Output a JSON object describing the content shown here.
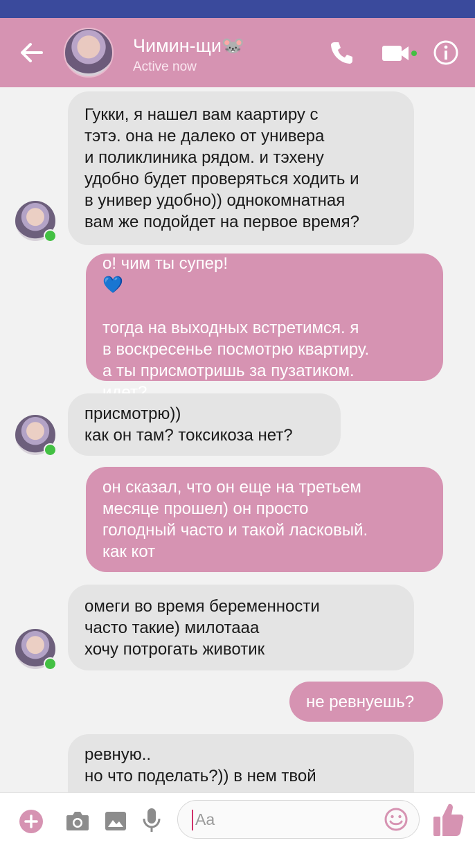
{
  "header": {
    "contact_name": "Чимин-щи🐭",
    "status": "Active now"
  },
  "messages": [
    {
      "side": "incoming",
      "text": "Гукки, я нашел вам каартиру с\nтэтэ. она не далеко от универа\nи поликлиника рядом. и тэхену\nудобно будет проверяться ходить и\nв универ удобно)) однокомнатная\nвам же подойдет на первое время?"
    },
    {
      "side": "outgoing",
      "text": "о! чим ты супер!",
      "emoji": "💙",
      "text2": "тогда на выходных встретимся. я\nв воскресенье посмотрю квартиру.\nа ты присмотришь за пузатиком.\nидет?"
    },
    {
      "side": "incoming",
      "text": "присмотрю))\nкак он там? токсикоза нет?"
    },
    {
      "side": "outgoing",
      "text": "он сказал, что он еще на третьем\nмесяце прошел) он просто\nголодный часто и такой ласковый.\nкак кот"
    },
    {
      "side": "incoming",
      "text": "омеги во время беременности\nчасто такие) милотааа\nхочу потрогать животик"
    },
    {
      "side": "outgoing",
      "text": "не ревнуешь?"
    },
    {
      "side": "incoming",
      "text": "ревную..\nно что поделать?)) в нем твой"
    }
  ],
  "composer": {
    "placeholder": "Aa"
  },
  "colors": {
    "accent": "#d693b2",
    "incoming_bubble": "#e4e4e4",
    "status_bar": "#3a4a9c",
    "online": "#43c043"
  },
  "icons": [
    "back-arrow-icon",
    "phone-icon",
    "video-camera-icon",
    "info-icon",
    "plus-icon",
    "camera-icon",
    "image-icon",
    "microphone-icon",
    "emoji-icon",
    "thumbs-up-icon"
  ]
}
